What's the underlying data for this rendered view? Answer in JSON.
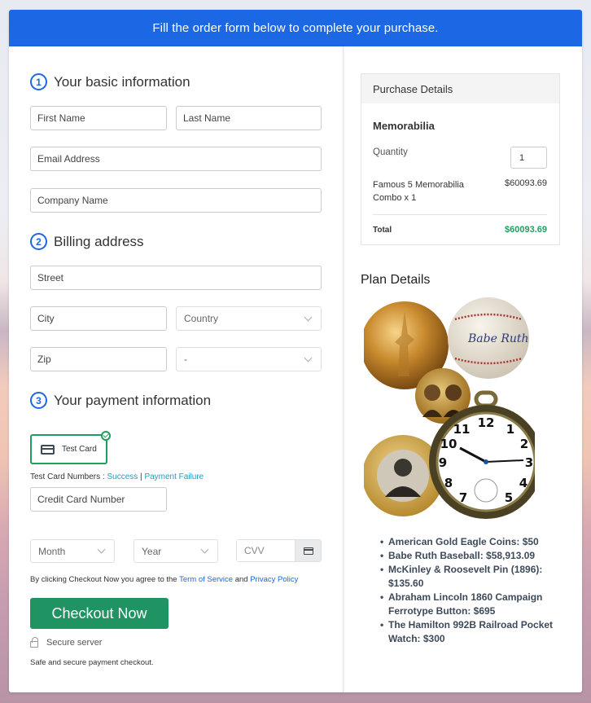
{
  "banner": {
    "text": "Fill the order form below to complete your purchase."
  },
  "basic": {
    "step": "1",
    "title": "Your basic information",
    "first_name": "First Name",
    "last_name": "Last Name",
    "email": "Email Address",
    "company": "Company Name"
  },
  "billing": {
    "step": "2",
    "title": "Billing address",
    "street": "Street",
    "city": "City",
    "country": "Country",
    "zip": "Zip",
    "state": "-"
  },
  "payment": {
    "step": "3",
    "title": "Your payment information",
    "method_label": "Test Card",
    "test_numbers_label": "Test Card Numbers : ",
    "success_link": "Success",
    "separator": " | ",
    "failure_link": "Payment Failure",
    "card_number": "Credit Card Number",
    "month": "Month",
    "year": "Year",
    "cvv": "CVV"
  },
  "terms": {
    "prefix": "By clicking Checkout Now you agree to the ",
    "tos": "Term of Service",
    "and": " and ",
    "privacy": "Privacy Policy"
  },
  "checkout": {
    "button": "Checkout Now",
    "secure": "Secure server",
    "note": "Safe and secure payment checkout."
  },
  "purchase": {
    "header": "Purchase Details",
    "product": "Memorabilia",
    "quantity_label": "Quantity",
    "quantity_value": "1",
    "line_item": "Famous 5 Memorabilia Combo x 1",
    "line_price": "$60093.69",
    "total_label": "Total",
    "total_value": "$60093.69",
    "total_color": "#1f9e5d"
  },
  "plan": {
    "title": "Plan Details",
    "image_alt": "Memorabilia collage: gold eagle coin, Babe Ruth baseball, McKinley & Roosevelt pin, Lincoln ferrotype button, Hamilton pocket watch",
    "items": [
      "American Gold Eagle Coins: $50",
      "Babe Ruth Baseball: $58,913.09",
      "McKinley & Roosevelt Pin (1896): $135.60",
      "Abraham Lincoln 1860 Campaign Ferrotype Button: $695",
      "The Hamilton 992B Railroad Pocket Watch: $300"
    ]
  },
  "colors": {
    "brand_blue": "#1b67e4",
    "checkout_green": "#1f9462",
    "link_teal": "#1b9ec2"
  }
}
